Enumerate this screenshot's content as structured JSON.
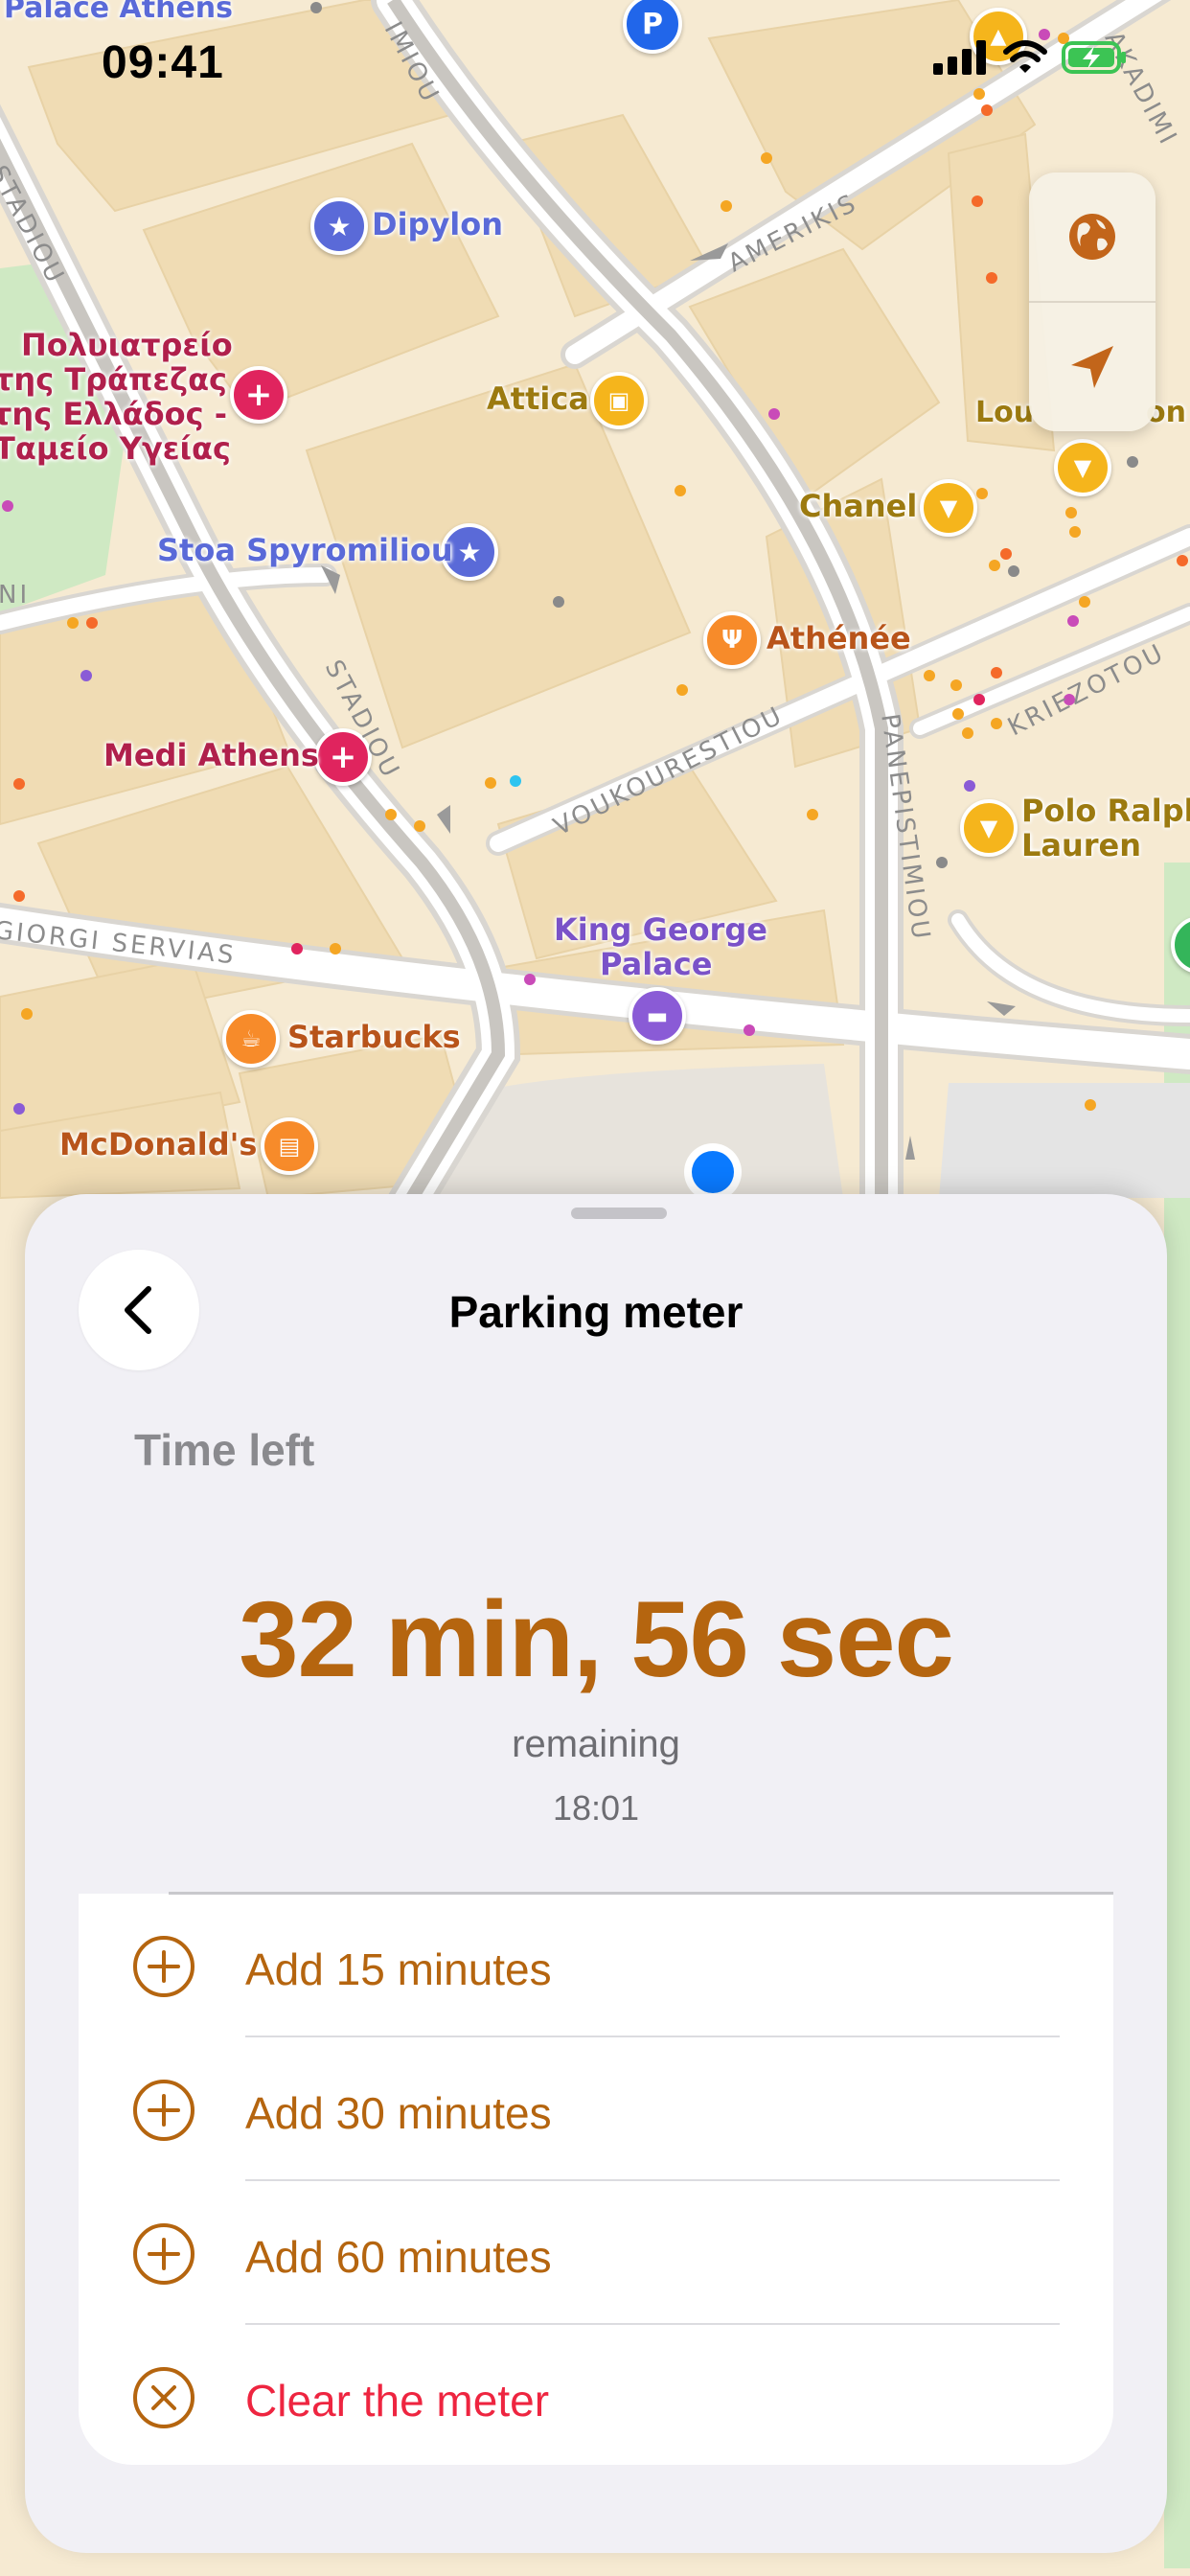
{
  "status_bar": {
    "time": "09:41"
  },
  "map": {
    "places": [
      {
        "id": "palace-athens",
        "label": "Palace Athens"
      },
      {
        "id": "dipylon",
        "label": "Dipylon"
      },
      {
        "id": "attica",
        "label": "Attica"
      },
      {
        "id": "chanel",
        "label": "Chanel"
      },
      {
        "id": "louis",
        "label": "Lou"
      },
      {
        "id": "louis2",
        "label": "on"
      },
      {
        "id": "stoa",
        "label": "Stoa Spyromiliou"
      },
      {
        "id": "athenee",
        "label": "Athénée"
      },
      {
        "id": "medi",
        "label": "Medi Athens"
      },
      {
        "id": "polo1",
        "label": "Polo Ralph"
      },
      {
        "id": "polo2",
        "label": "Lauren"
      },
      {
        "id": "kinggeorge1",
        "label": "King George"
      },
      {
        "id": "kinggeorge2",
        "label": "Palace"
      },
      {
        "id": "starbucks",
        "label": "Starbucks"
      },
      {
        "id": "mcdonalds",
        "label": "McDonald's"
      },
      {
        "id": "greek1",
        "label": "Πολυιατρείο"
      },
      {
        "id": "greek2",
        "label": "της Τράπεζας"
      },
      {
        "id": "greek3",
        "label": "της Ελλάδος -"
      },
      {
        "id": "greek4",
        "label": "Ταμείο Υγείας"
      }
    ],
    "streets": [
      {
        "id": "stadiou-top",
        "label": "STADIOU"
      },
      {
        "id": "stadiou-mid",
        "label": "STADIOU"
      },
      {
        "id": "amerikis",
        "label": "AMERIKIS"
      },
      {
        "id": "voukourestiou",
        "label": "VOUKOURESTIOU"
      },
      {
        "id": "panepistimiou",
        "label": "PANEPISTIMIOU"
      },
      {
        "id": "kriezotou",
        "label": "KRIEZOTOU"
      },
      {
        "id": "servias",
        "label": "GIORGI SERVIAS"
      },
      {
        "id": "akadimias",
        "label": "AKADIMI"
      },
      {
        "id": "imiou",
        "label": "IMIOU"
      },
      {
        "id": "ni",
        "label": "NI"
      }
    ]
  },
  "sheet": {
    "title": "Parking meter",
    "time_left_label": "Time left",
    "countdown": "32 min, 56 sec",
    "remaining_label": "remaining",
    "expiry_time": "18:01",
    "actions": [
      {
        "label": "Add 15 minutes",
        "icon": "plus-circle-icon"
      },
      {
        "label": "Add 30 minutes",
        "icon": "plus-circle-icon"
      },
      {
        "label": "Add 60 minutes",
        "icon": "plus-circle-icon"
      },
      {
        "label": "Clear the meter",
        "icon": "x-circle-icon"
      }
    ]
  },
  "colors": {
    "accent": "#b5650f",
    "destructive": "#ee2540",
    "sheet_background": "#f1f0f5",
    "map_land": "#f6ead2",
    "map_building": "#f0dcb4",
    "user_location": "#0a7aff"
  }
}
